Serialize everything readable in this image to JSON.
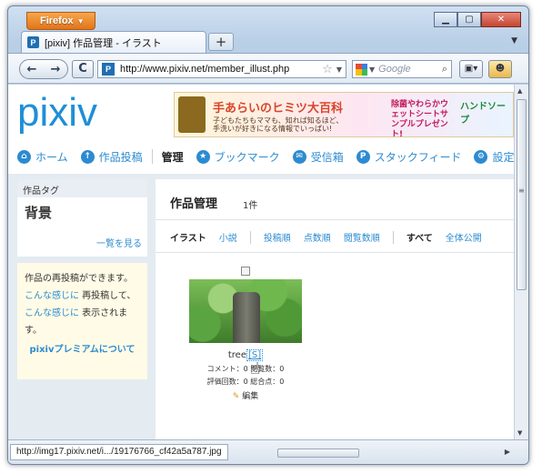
{
  "browser": {
    "menu_button": "Firefox",
    "tab_title": "[pixiv] 作品管理 - イラスト",
    "new_tab": "+",
    "url": "http://www.pixiv.net/member_illust.php",
    "search_placeholder": "Google",
    "status_url": "http://img17.pixiv.net/i.../19176766_cf42a5a787.jpg"
  },
  "site": {
    "logo": "pixiv",
    "banner_headline": "手あらいのヒミツ大百科",
    "banner_text": "子どもたちもママも、知れば知るほど、手洗いが好きになる情報でいっぱい!",
    "banner_promo": "除菌やわらかウェットシートサンプルプレゼント!",
    "banner_brand": "ハンドソープ"
  },
  "nav": {
    "items": [
      {
        "label": "ホーム",
        "icon": "home-icon"
      },
      {
        "label": "作品投稿",
        "icon": "upload-icon"
      },
      {
        "label": "管理",
        "icon": ""
      },
      {
        "label": "ブックマーク",
        "icon": "star-icon"
      },
      {
        "label": "受信箱",
        "icon": "mail-icon"
      },
      {
        "label": "スタックフィード",
        "icon": "feed-icon"
      },
      {
        "label": "設定",
        "icon": "gear-icon"
      }
    ]
  },
  "sidebar": {
    "tag_header": "作品タグ",
    "tag_name": "背景",
    "tag_more": "一覧を見る",
    "info_line1": "作品の再投稿ができます。",
    "info_link1": "こんな感じに",
    "info_text1": " 再投稿して、",
    "info_link2": "こんな感じに",
    "info_text2": " 表示されます。",
    "premium_link": "pixivプレミアムについて"
  },
  "main": {
    "title": "作品管理",
    "count": "1件",
    "filters": {
      "illust": "イラスト",
      "novel": "小説",
      "sort_post": "投稿順",
      "sort_score": "点数順",
      "sort_views": "閲覧数順",
      "all": "すべて",
      "public": "全体公開"
    },
    "work": {
      "name": "tree",
      "s_link": "[S]",
      "comments": "コメント：0",
      "views": "閲覧数：0",
      "ratings": "評価回数：0",
      "total_score": "総合点：0",
      "edit": "編集"
    }
  },
  "colors": {
    "accent": "#2c8bd1",
    "firefox_orange": "#e0751c"
  }
}
